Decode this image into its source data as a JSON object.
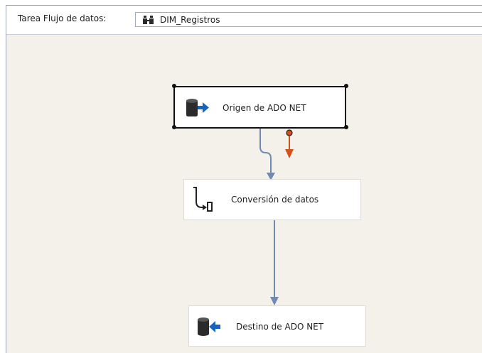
{
  "toolbar": {
    "label": "Tarea Flujo de datos:",
    "selected_task": "DIM_Registros",
    "task_icon": "data-flow-task-icon"
  },
  "nodes": [
    {
      "id": "source",
      "label": "Origen de ADO NET",
      "icon": "ado-net-source-icon",
      "selected": true
    },
    {
      "id": "conversion",
      "label": "Conversión de datos",
      "icon": "data-conversion-icon",
      "selected": false
    },
    {
      "id": "destination",
      "label": "Destino de ADO NET",
      "icon": "ado-net-destination-icon",
      "selected": false
    }
  ],
  "paths": [
    {
      "from": "source",
      "to": "conversion",
      "type": "data-flow",
      "color": "#6f8ab5"
    },
    {
      "from": "conversion",
      "to": "destination",
      "type": "data-flow",
      "color": "#6f8ab5"
    },
    {
      "from": "source",
      "to": null,
      "type": "error-output",
      "color": "#d2521c"
    }
  ],
  "colors": {
    "canvas": "#f4f1ea",
    "data_path": "#6f8ab5",
    "error_path": "#d2521c",
    "source_arrow": "#1565c0"
  }
}
